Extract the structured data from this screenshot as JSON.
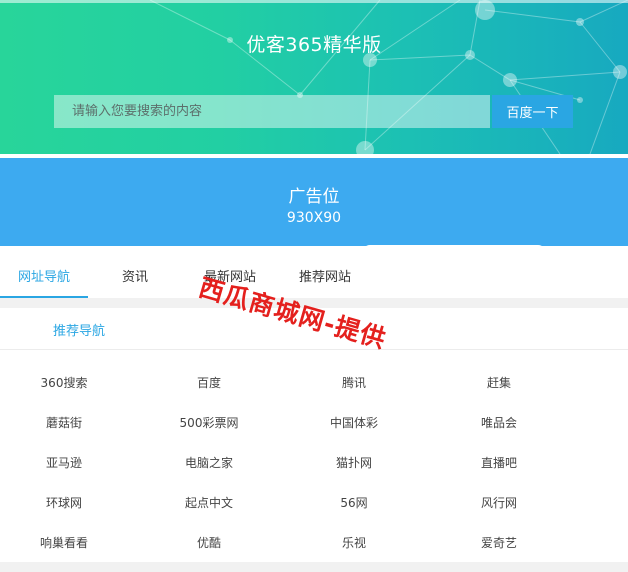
{
  "hero": {
    "title": "优客365精华版",
    "search_placeholder": "请输入您要搜索的内容",
    "search_button": "百度一下"
  },
  "ad": {
    "title": "广告位",
    "size": "930X90"
  },
  "tabs": [
    {
      "label": "网址导航",
      "active": true
    },
    {
      "label": "资讯",
      "active": false
    },
    {
      "label": "最新网站",
      "active": false
    },
    {
      "label": "推荐网站",
      "active": false
    }
  ],
  "section": {
    "title": "推荐导航"
  },
  "links": [
    [
      "360搜索",
      "百度",
      "腾讯",
      "赶集"
    ],
    [
      "蘑菇街",
      "500彩票网",
      "中国体彩",
      "唯品会"
    ],
    [
      "亚马逊",
      "电脑之家",
      "猫扑网",
      "直播吧"
    ],
    [
      "环球网",
      "起点中文",
      "56网",
      "风行网"
    ],
    [
      "响巢看看",
      "优酷",
      "乐视",
      "爱奇艺"
    ]
  ],
  "watermark": "西瓜商城网-提供",
  "colors": {
    "accent": "#2aa6e3",
    "ad_bg": "#3daaf0",
    "hero_start": "#28d59a",
    "hero_end": "#17a9c0",
    "watermark": "#e4201d"
  }
}
